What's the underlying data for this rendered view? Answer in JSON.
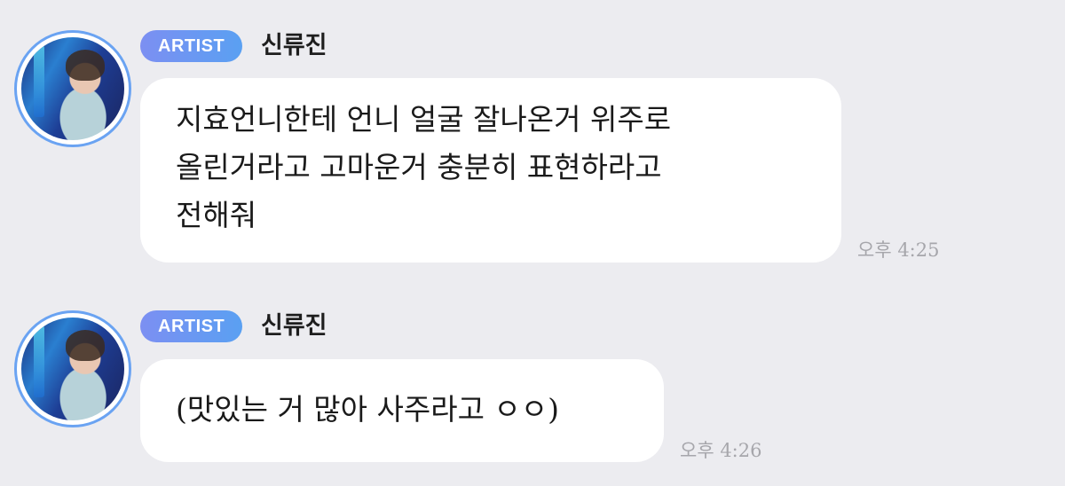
{
  "messages": [
    {
      "badge": "ARTIST",
      "sender": "신류진",
      "text": "지효언니한테 언니 얼굴 잘나온거 위주로\n올린거라고 고마운거 충분히 표현하라고\n전해줘",
      "time": "오후 4:25"
    },
    {
      "badge": "ARTIST",
      "sender": "신류진",
      "text": "(맛있는 거 많아 사주라고 ㅇㅇ)",
      "time": "오후 4:26"
    }
  ],
  "colors": {
    "background": "#ececf0",
    "bubble": "#ffffff",
    "badge_gradient_start": "#7c8ff2",
    "badge_gradient_end": "#5aa0f2",
    "avatar_ring": "#6aa3f2",
    "time_text": "#a6a6ab"
  }
}
